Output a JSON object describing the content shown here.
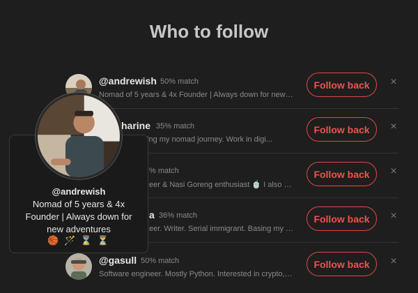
{
  "page": {
    "title": "Who to follow"
  },
  "suggestions": [
    {
      "handle": "@andrewish",
      "match": "50% match",
      "bio": "Nomad of 5 years & 4x Founder | Always down for new ad...",
      "follow_label": "Follow back"
    },
    {
      "handle": "harine",
      "match": "35% match",
      "bio": "st starting my nomad journey. Work in digi...",
      "follow_label": "Follow back"
    },
    {
      "handle": "",
      "match": "% match",
      "bio": "eer & Nasi Goreng enthusiast 🍵 I also play...",
      "follow_label": "Follow back"
    },
    {
      "handle": "a",
      "match": "36% match",
      "bio": "eer. Writer. Serial immigrant. Basing my tri...",
      "follow_label": "Follow back"
    },
    {
      "handle": "@gasull",
      "match": "50% match",
      "bio": "Software engineer. Mostly Python. Interested in crypto, n...",
      "follow_label": "Follow back"
    }
  ],
  "dismiss_glyph": "×",
  "hovercard": {
    "handle": "@andrewish",
    "bio": "Nomad of 5 years & 4x Founder | Always down for new adventures",
    "emojis": "🏀 🪄 ⌛ ⏳"
  },
  "colors": {
    "accent": "#f0524c",
    "background": "#1e1e1e",
    "muted": "#8a8a8a"
  }
}
